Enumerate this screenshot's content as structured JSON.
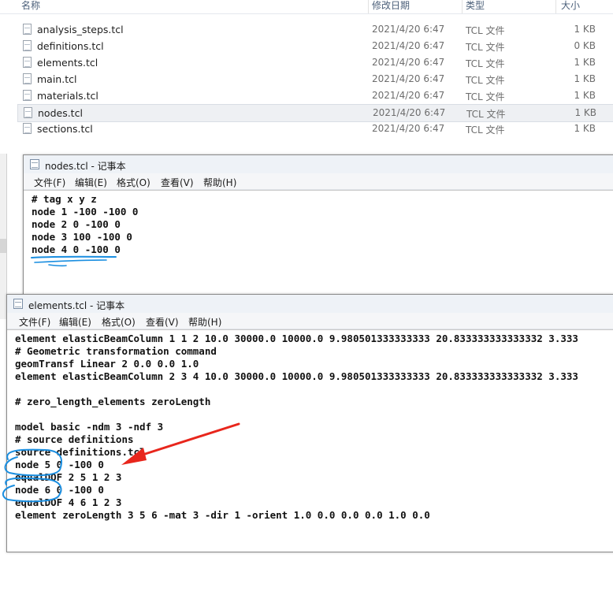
{
  "explorer": {
    "columns": {
      "name": "名称",
      "date": "修改日期",
      "type": "类型",
      "size": "大小"
    },
    "files": [
      {
        "name": "analysis_steps.tcl",
        "date": "2021/4/20 6:47",
        "type": "TCL 文件",
        "size": "1 KB"
      },
      {
        "name": "definitions.tcl",
        "date": "2021/4/20 6:47",
        "type": "TCL 文件",
        "size": "0 KB"
      },
      {
        "name": "elements.tcl",
        "date": "2021/4/20 6:47",
        "type": "TCL 文件",
        "size": "1 KB"
      },
      {
        "name": "main.tcl",
        "date": "2021/4/20 6:47",
        "type": "TCL 文件",
        "size": "1 KB"
      },
      {
        "name": "materials.tcl",
        "date": "2021/4/20 6:47",
        "type": "TCL 文件",
        "size": "1 KB"
      },
      {
        "name": "nodes.tcl",
        "date": "2021/4/20 6:47",
        "type": "TCL 文件",
        "size": "1 KB"
      },
      {
        "name": "sections.tcl",
        "date": "2021/4/20 6:47",
        "type": "TCL 文件",
        "size": "1 KB"
      }
    ],
    "selected_file": "nodes.tcl"
  },
  "notepad_menu": {
    "file": "文件(F)",
    "edit": "编辑(E)",
    "format": "格式(O)",
    "view": "查看(V)",
    "help": "帮助(H)"
  },
  "nodes_window": {
    "title": "nodes.tcl - 记事本",
    "lines": [
      "# tag x y z",
      "node 1 -100 -100 0",
      "node 2 0 -100 0",
      "node 3 100 -100 0",
      "node 4 0 -100 0"
    ]
  },
  "elements_window": {
    "title": "elements.tcl - 记事本",
    "lines": [
      "element elasticBeamColumn 1 1 2 10.0 30000.0 10000.0 9.980501333333333 20.833333333333332 3.333",
      "# Geometric transformation command",
      "geomTransf Linear 2 0.0 0.0 1.0",
      "element elasticBeamColumn 2 3 4 10.0 30000.0 10000.0 9.980501333333333 20.833333333333332 3.333",
      "",
      "# zero_length_elements zeroLength",
      "",
      "model basic -ndm 3 -ndf 3",
      "# source definitions",
      "source definitions.tcl",
      "node 5 0 -100 0",
      "equalDOF 2 5 1 2 3",
      "node 6 0 -100 0",
      "equalDOF 4 6 1 2 3",
      "element zeroLength 3 5 6 -mat 3 -dir 1 -orient 1.0 0.0 0.0 0.0 1.0 0.0"
    ]
  },
  "colors": {
    "annotation_blue": "#1a8ee0",
    "annotation_red": "#e8261c"
  }
}
